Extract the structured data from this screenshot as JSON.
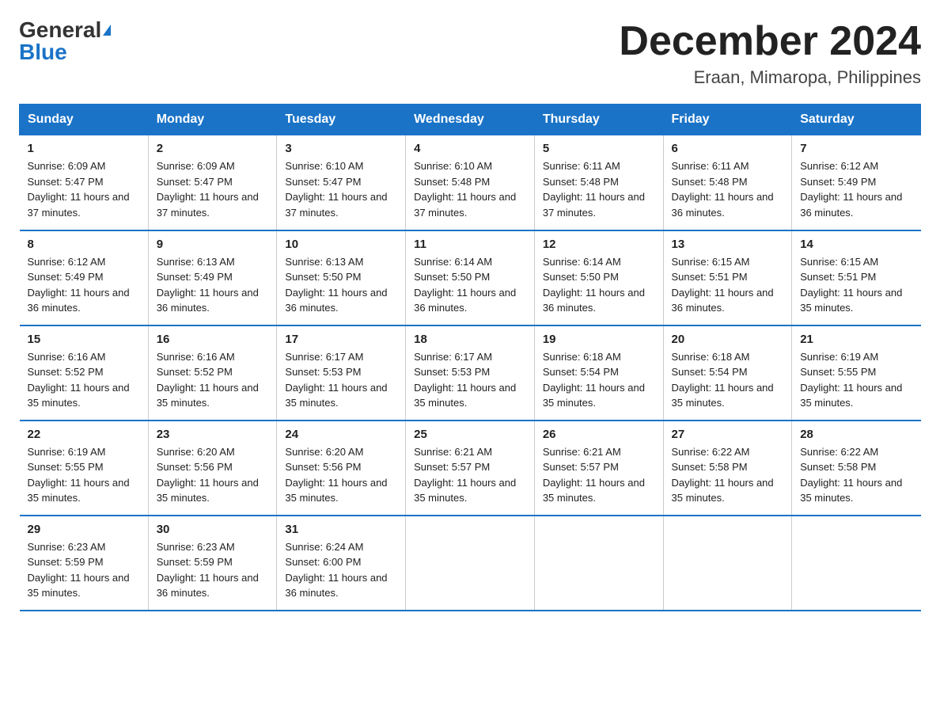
{
  "header": {
    "logo_general": "General",
    "logo_blue": "Blue",
    "month": "December 2024",
    "location": "Eraan, Mimaropa, Philippines"
  },
  "days_of_week": [
    "Sunday",
    "Monday",
    "Tuesday",
    "Wednesday",
    "Thursday",
    "Friday",
    "Saturday"
  ],
  "weeks": [
    [
      {
        "day": "1",
        "sunrise": "6:09 AM",
        "sunset": "5:47 PM",
        "daylight": "11 hours and 37 minutes."
      },
      {
        "day": "2",
        "sunrise": "6:09 AM",
        "sunset": "5:47 PM",
        "daylight": "11 hours and 37 minutes."
      },
      {
        "day": "3",
        "sunrise": "6:10 AM",
        "sunset": "5:47 PM",
        "daylight": "11 hours and 37 minutes."
      },
      {
        "day": "4",
        "sunrise": "6:10 AM",
        "sunset": "5:48 PM",
        "daylight": "11 hours and 37 minutes."
      },
      {
        "day": "5",
        "sunrise": "6:11 AM",
        "sunset": "5:48 PM",
        "daylight": "11 hours and 37 minutes."
      },
      {
        "day": "6",
        "sunrise": "6:11 AM",
        "sunset": "5:48 PM",
        "daylight": "11 hours and 36 minutes."
      },
      {
        "day": "7",
        "sunrise": "6:12 AM",
        "sunset": "5:49 PM",
        "daylight": "11 hours and 36 minutes."
      }
    ],
    [
      {
        "day": "8",
        "sunrise": "6:12 AM",
        "sunset": "5:49 PM",
        "daylight": "11 hours and 36 minutes."
      },
      {
        "day": "9",
        "sunrise": "6:13 AM",
        "sunset": "5:49 PM",
        "daylight": "11 hours and 36 minutes."
      },
      {
        "day": "10",
        "sunrise": "6:13 AM",
        "sunset": "5:50 PM",
        "daylight": "11 hours and 36 minutes."
      },
      {
        "day": "11",
        "sunrise": "6:14 AM",
        "sunset": "5:50 PM",
        "daylight": "11 hours and 36 minutes."
      },
      {
        "day": "12",
        "sunrise": "6:14 AM",
        "sunset": "5:50 PM",
        "daylight": "11 hours and 36 minutes."
      },
      {
        "day": "13",
        "sunrise": "6:15 AM",
        "sunset": "5:51 PM",
        "daylight": "11 hours and 36 minutes."
      },
      {
        "day": "14",
        "sunrise": "6:15 AM",
        "sunset": "5:51 PM",
        "daylight": "11 hours and 35 minutes."
      }
    ],
    [
      {
        "day": "15",
        "sunrise": "6:16 AM",
        "sunset": "5:52 PM",
        "daylight": "11 hours and 35 minutes."
      },
      {
        "day": "16",
        "sunrise": "6:16 AM",
        "sunset": "5:52 PM",
        "daylight": "11 hours and 35 minutes."
      },
      {
        "day": "17",
        "sunrise": "6:17 AM",
        "sunset": "5:53 PM",
        "daylight": "11 hours and 35 minutes."
      },
      {
        "day": "18",
        "sunrise": "6:17 AM",
        "sunset": "5:53 PM",
        "daylight": "11 hours and 35 minutes."
      },
      {
        "day": "19",
        "sunrise": "6:18 AM",
        "sunset": "5:54 PM",
        "daylight": "11 hours and 35 minutes."
      },
      {
        "day": "20",
        "sunrise": "6:18 AM",
        "sunset": "5:54 PM",
        "daylight": "11 hours and 35 minutes."
      },
      {
        "day": "21",
        "sunrise": "6:19 AM",
        "sunset": "5:55 PM",
        "daylight": "11 hours and 35 minutes."
      }
    ],
    [
      {
        "day": "22",
        "sunrise": "6:19 AM",
        "sunset": "5:55 PM",
        "daylight": "11 hours and 35 minutes."
      },
      {
        "day": "23",
        "sunrise": "6:20 AM",
        "sunset": "5:56 PM",
        "daylight": "11 hours and 35 minutes."
      },
      {
        "day": "24",
        "sunrise": "6:20 AM",
        "sunset": "5:56 PM",
        "daylight": "11 hours and 35 minutes."
      },
      {
        "day": "25",
        "sunrise": "6:21 AM",
        "sunset": "5:57 PM",
        "daylight": "11 hours and 35 minutes."
      },
      {
        "day": "26",
        "sunrise": "6:21 AM",
        "sunset": "5:57 PM",
        "daylight": "11 hours and 35 minutes."
      },
      {
        "day": "27",
        "sunrise": "6:22 AM",
        "sunset": "5:58 PM",
        "daylight": "11 hours and 35 minutes."
      },
      {
        "day": "28",
        "sunrise": "6:22 AM",
        "sunset": "5:58 PM",
        "daylight": "11 hours and 35 minutes."
      }
    ],
    [
      {
        "day": "29",
        "sunrise": "6:23 AM",
        "sunset": "5:59 PM",
        "daylight": "11 hours and 35 minutes."
      },
      {
        "day": "30",
        "sunrise": "6:23 AM",
        "sunset": "5:59 PM",
        "daylight": "11 hours and 36 minutes."
      },
      {
        "day": "31",
        "sunrise": "6:24 AM",
        "sunset": "6:00 PM",
        "daylight": "11 hours and 36 minutes."
      },
      null,
      null,
      null,
      null
    ]
  ]
}
